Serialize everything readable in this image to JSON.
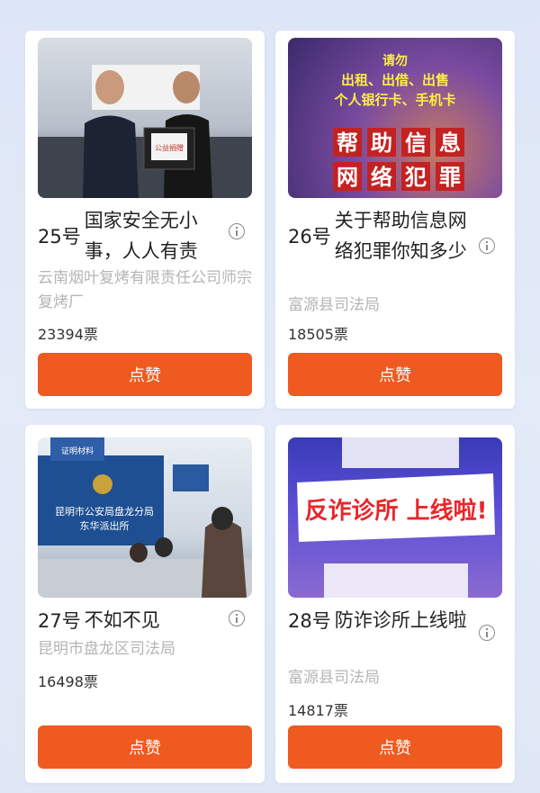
{
  "items": [
    {
      "number": "25号",
      "title": "国家安全无小事，人人有责",
      "org": "云南烟叶复烤有限责任公司师宗复烤厂",
      "votes": "23394票",
      "button": "点赞",
      "image_text": "公益捐赠"
    },
    {
      "number": "26号",
      "title": "关于帮助信息网络犯罪你知多少",
      "org": "富源县司法局",
      "votes": "18505票",
      "button": "点赞",
      "image_lines": [
        "请勿",
        "出租、出借、出售",
        "个人银行卡、手机卡"
      ],
      "image_chars": [
        "帮",
        "助",
        "信",
        "息",
        "网",
        "络",
        "犯",
        "罪"
      ]
    },
    {
      "number": "27号",
      "title": "不如不见",
      "org": "昆明市盘龙区司法局",
      "votes": "16498票",
      "button": "点赞",
      "image_sign1": "昆明市公安局盘龙分局",
      "image_sign2": "东华派出所",
      "image_board": "证明材料"
    },
    {
      "number": "28号",
      "title": "防诈诊所上线啦",
      "org": "富源县司法局",
      "votes": "14817票",
      "button": "点赞",
      "image_banner": "反诈诊所 上线啦!"
    }
  ]
}
